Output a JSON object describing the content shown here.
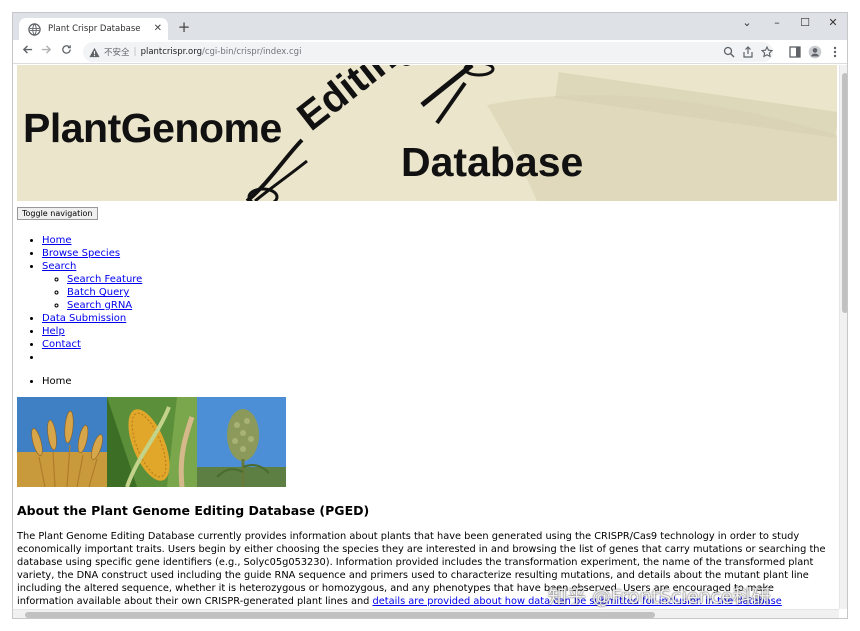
{
  "browser": {
    "tab_title": "Plant Crispr Database",
    "new_tab": "+",
    "insecure_label": "不安全",
    "url_host": "plantcrispr.org",
    "url_path": "/cgi-bin/crispr/index.cgi",
    "window_controls": {
      "minimize": "–",
      "maximize": "☐",
      "close": "✕",
      "dropdown": "⌄"
    }
  },
  "banner": {
    "line1": "PlantGenome",
    "line2": "Editing",
    "line3": "Database",
    "bg_color": "#ebe5cb"
  },
  "toggle_label": "Toggle navigation",
  "nav": {
    "items": [
      {
        "label": "Home"
      },
      {
        "label": "Browse Species"
      },
      {
        "label": "Search"
      },
      {
        "label": "Data Submission"
      },
      {
        "label": "Help"
      },
      {
        "label": "Contact"
      }
    ],
    "search_sub": [
      {
        "label": "Search Feature"
      },
      {
        "label": "Batch Query"
      },
      {
        "label": "Search gRNA"
      }
    ]
  },
  "breadcrumb": {
    "current": "Home"
  },
  "about": {
    "heading": "About the Plant Genome Editing Database (PGED)",
    "text": "The Plant Genome Editing Database currently provides information about plants that have been generated using the CRISPR/Cas9 technology in order to study economically important traits. Users begin by either choosing the species they are interested in and browsing the list of genes that carry mutations or searching the database using specific gene identifiers (e.g., Solyc05g053230). Information provided includes the transformation experiment, the name of the transformed plant variety, the DNA construct used including the guide RNA sequence and primers used to characterize resulting mutations, and details about the mutant plant line including the altered sequence, whether it is heterozygous or homozygous, and any phenotypes that have been observed. Users are encouraged to make information available about their own CRISPR-generated plant lines and ",
    "link": "details are provided about how data can be submitted for inclusion in the database"
  },
  "watermark": "知乎 @FrontScience科研"
}
